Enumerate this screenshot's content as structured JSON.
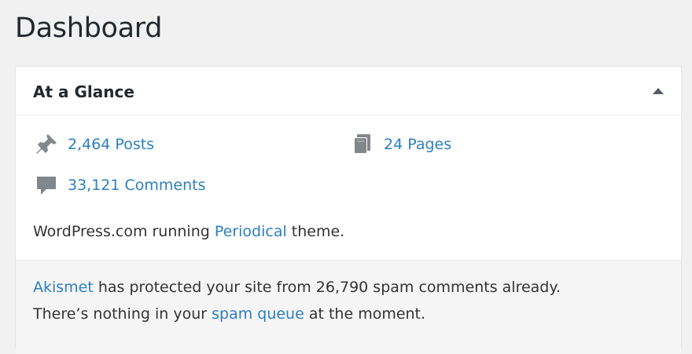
{
  "page": {
    "title": "Dashboard"
  },
  "widget": {
    "title": "At a Glance",
    "toggle_icon": "triangle-up-icon",
    "items": [
      {
        "icon": "pin-icon",
        "label": "2,464 Posts"
      },
      {
        "icon": "pages-icon",
        "label": "24 Pages"
      },
      {
        "icon": "comment-icon",
        "label": "33,121 Comments"
      }
    ],
    "theme_line": {
      "prefix": "WordPress.com running ",
      "theme_name": "Periodical",
      "suffix": " theme."
    },
    "akismet": {
      "link1": "Akismet",
      "line1_rest": " has protected your site from 26,790 spam comments already.",
      "line2_prefix": "There’s nothing in your ",
      "link2": "spam queue",
      "line2_suffix": " at the moment."
    }
  },
  "colors": {
    "link": "#2c7fbf",
    "icon": "#82878c",
    "background": "#f1f1f1",
    "text": "#23282d"
  }
}
